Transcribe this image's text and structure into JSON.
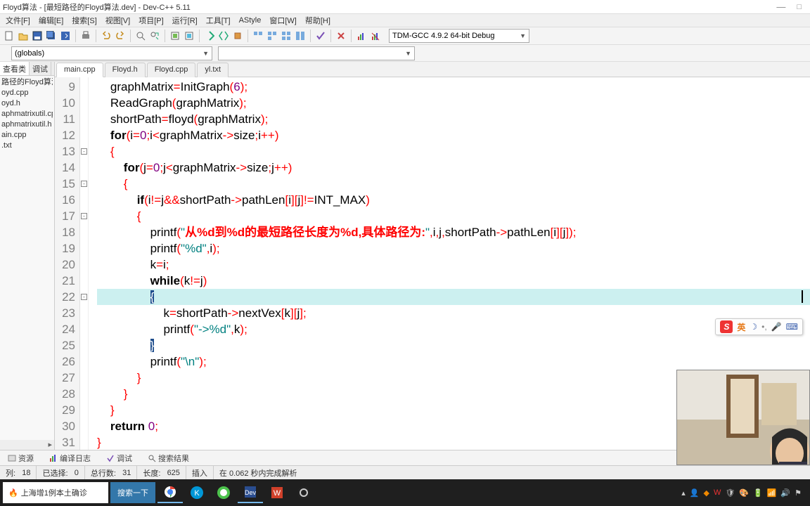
{
  "title": "Floyd算法 - [最短路径的Floyd算法.dev] - Dev-C++ 5.11",
  "menu": [
    "文件[F]",
    "编辑[E]",
    "搜索[S]",
    "视图[V]",
    "项目[P]",
    "运行[R]",
    "工具[T]",
    "AStyle",
    "窗口[W]",
    "帮助[H]"
  ],
  "compiler_combo": "TDM-GCC 4.9.2 64-bit Debug",
  "scope_combo": "(globals)",
  "left_tabs": [
    "查看类",
    "调试"
  ],
  "project_tree": {
    "root": "路径的Floyd算法",
    "files": [
      "oyd.cpp",
      "oyd.h",
      "aphmatrixutil.cp",
      "aphmatrixutil.h",
      "ain.cpp",
      ".txt"
    ]
  },
  "file_tabs": [
    "main.cpp",
    "Floyd.h",
    "Floyd.cpp",
    "yl.txt"
  ],
  "active_file": 0,
  "code_first_line": 9,
  "code_lines": [
    [
      [
        " ",
        "    "
      ],
      [
        "ident",
        "graphMatrix"
      ],
      [
        "sym",
        "="
      ],
      [
        "ident",
        "InitGraph"
      ],
      [
        "sym",
        "("
      ],
      [
        "num",
        "6"
      ],
      [
        "sym",
        ");"
      ]
    ],
    [
      [
        " ",
        "    "
      ],
      [
        "ident",
        "ReadGraph"
      ],
      [
        "sym",
        "("
      ],
      [
        "ident",
        "graphMatrix"
      ],
      [
        "sym",
        ");"
      ]
    ],
    [
      [
        " ",
        "    "
      ],
      [
        "ident",
        "shortPath"
      ],
      [
        "sym",
        "="
      ],
      [
        "ident",
        "floyd"
      ],
      [
        "sym",
        "("
      ],
      [
        "ident",
        "graphMatrix"
      ],
      [
        "sym",
        ");"
      ]
    ],
    [
      [
        " ",
        "    "
      ],
      [
        "kw",
        "for"
      ],
      [
        "sym",
        "("
      ],
      [
        "ident",
        "i"
      ],
      [
        "sym",
        "="
      ],
      [
        "num",
        "0"
      ],
      [
        "sym",
        ";"
      ],
      [
        "ident",
        "i"
      ],
      [
        "sym",
        "<"
      ],
      [
        "ident",
        "graphMatrix"
      ],
      [
        "sym",
        "->"
      ],
      [
        "ident",
        "size"
      ],
      [
        "sym",
        ";"
      ],
      [
        "ident",
        "i"
      ],
      [
        "sym",
        "++)"
      ]
    ],
    [
      [
        " ",
        "    "
      ],
      [
        "sym",
        "{"
      ]
    ],
    [
      [
        " ",
        "        "
      ],
      [
        "kw",
        "for"
      ],
      [
        "sym",
        "("
      ],
      [
        "ident",
        "j"
      ],
      [
        "sym",
        "="
      ],
      [
        "num",
        "0"
      ],
      [
        "sym",
        ";"
      ],
      [
        "ident",
        "j"
      ],
      [
        "sym",
        "<"
      ],
      [
        "ident",
        "graphMatrix"
      ],
      [
        "sym",
        "->"
      ],
      [
        "ident",
        "size"
      ],
      [
        "sym",
        ";"
      ],
      [
        "ident",
        "j"
      ],
      [
        "sym",
        "++)"
      ]
    ],
    [
      [
        " ",
        "        "
      ],
      [
        "sym",
        "{"
      ]
    ],
    [
      [
        " ",
        "            "
      ],
      [
        "kw",
        "if"
      ],
      [
        "sym",
        "("
      ],
      [
        "ident",
        "i"
      ],
      [
        "sym",
        "!="
      ],
      [
        "ident",
        "j"
      ],
      [
        "sym",
        "&&"
      ],
      [
        "ident",
        "shortPath"
      ],
      [
        "sym",
        "->"
      ],
      [
        "ident",
        "pathLen"
      ],
      [
        "sym",
        "["
      ],
      [
        "ident",
        "i"
      ],
      [
        "sym",
        "]["
      ],
      [
        "ident",
        "j"
      ],
      [
        "sym",
        "]!="
      ],
      [
        "ident",
        "INT_MAX"
      ],
      [
        "sym",
        ")"
      ]
    ],
    [
      [
        " ",
        "            "
      ],
      [
        "sym",
        "{"
      ]
    ],
    [
      [
        " ",
        "                "
      ],
      [
        "ident",
        "printf"
      ],
      [
        "sym",
        "("
      ],
      [
        "str",
        "\""
      ],
      [
        "str-cn",
        "从%d到%d的最短路径长度为%d,具体路径为:"
      ],
      [
        "str",
        "\""
      ],
      [
        "sym",
        ","
      ],
      [
        "ident",
        "i"
      ],
      [
        "sym",
        ","
      ],
      [
        "ident",
        "j"
      ],
      [
        "sym",
        ","
      ],
      [
        "ident",
        "shortPath"
      ],
      [
        "sym",
        "->"
      ],
      [
        "ident",
        "pathLen"
      ],
      [
        "sym",
        "["
      ],
      [
        "ident",
        "i"
      ],
      [
        "sym",
        "]["
      ],
      [
        "ident",
        "j"
      ],
      [
        "sym",
        "]);"
      ]
    ],
    [
      [
        " ",
        "                "
      ],
      [
        "ident",
        "printf"
      ],
      [
        "sym",
        "("
      ],
      [
        "str",
        "\"%d\""
      ],
      [
        "sym",
        ","
      ],
      [
        "ident",
        "i"
      ],
      [
        "sym",
        ");"
      ]
    ],
    [
      [
        " ",
        "                "
      ],
      [
        "ident",
        "k"
      ],
      [
        "sym",
        "="
      ],
      [
        "ident",
        "i"
      ],
      [
        "sym",
        ";"
      ]
    ],
    [
      [
        " ",
        "                "
      ],
      [
        "kw",
        "while"
      ],
      [
        "sym",
        "("
      ],
      [
        "ident",
        "k"
      ],
      [
        "sym",
        "!="
      ],
      [
        "ident",
        "j"
      ],
      [
        "sym",
        ")"
      ]
    ],
    [
      [
        " ",
        "                "
      ],
      [
        "brace-hl",
        "{"
      ]
    ],
    [
      [
        " ",
        "                    "
      ],
      [
        "ident",
        "k"
      ],
      [
        "sym",
        "="
      ],
      [
        "ident",
        "shortPath"
      ],
      [
        "sym",
        "->"
      ],
      [
        "ident",
        "nextVex"
      ],
      [
        "sym",
        "["
      ],
      [
        "ident",
        "k"
      ],
      [
        "sym",
        "]["
      ],
      [
        "ident",
        "j"
      ],
      [
        "sym",
        "];"
      ]
    ],
    [
      [
        " ",
        "                    "
      ],
      [
        "ident",
        "printf"
      ],
      [
        "sym",
        "("
      ],
      [
        "str",
        "\"->%d\""
      ],
      [
        "sym",
        ","
      ],
      [
        "ident",
        "k"
      ],
      [
        "sym",
        ");"
      ]
    ],
    [
      [
        " ",
        "                "
      ],
      [
        "brace-hl",
        "}"
      ]
    ],
    [
      [
        " ",
        "                "
      ],
      [
        "ident",
        "printf"
      ],
      [
        "sym",
        "("
      ],
      [
        "str",
        "\"\\n\""
      ],
      [
        "sym",
        ");"
      ]
    ],
    [
      [
        " ",
        "            "
      ],
      [
        "sym",
        "}"
      ]
    ],
    [
      [
        " ",
        "        "
      ],
      [
        "sym",
        "}"
      ]
    ],
    [
      [
        " ",
        "    "
      ],
      [
        "sym",
        "}"
      ]
    ],
    [
      [
        " ",
        "    "
      ],
      [
        "kw",
        "return"
      ],
      [
        " ",
        " "
      ],
      [
        "num",
        "0"
      ],
      [
        "sym",
        ";"
      ]
    ],
    [
      [
        "sym",
        "}"
      ]
    ]
  ],
  "highlighted_line_index": 13,
  "fold_markers": {
    "4": "-",
    "6": "-",
    "8": "-",
    "13": "-"
  },
  "bottom_tabs": [
    "资源",
    "编译日志",
    "调试",
    "搜索结果"
  ],
  "status": {
    "col_label": "列:",
    "col_val": "18",
    "sel_label": "已选择:",
    "sel_val": "0",
    "lines_label": "总行数:",
    "lines_val": "31",
    "len_label": "长度:",
    "len_val": "625",
    "mode": "插入",
    "parse": "在 0.062 秒内完成解析"
  },
  "taskbar": {
    "search_placeholder": "上海增1例本土确诊",
    "search_btn": "搜索一下"
  },
  "ime": {
    "lang": "英"
  }
}
